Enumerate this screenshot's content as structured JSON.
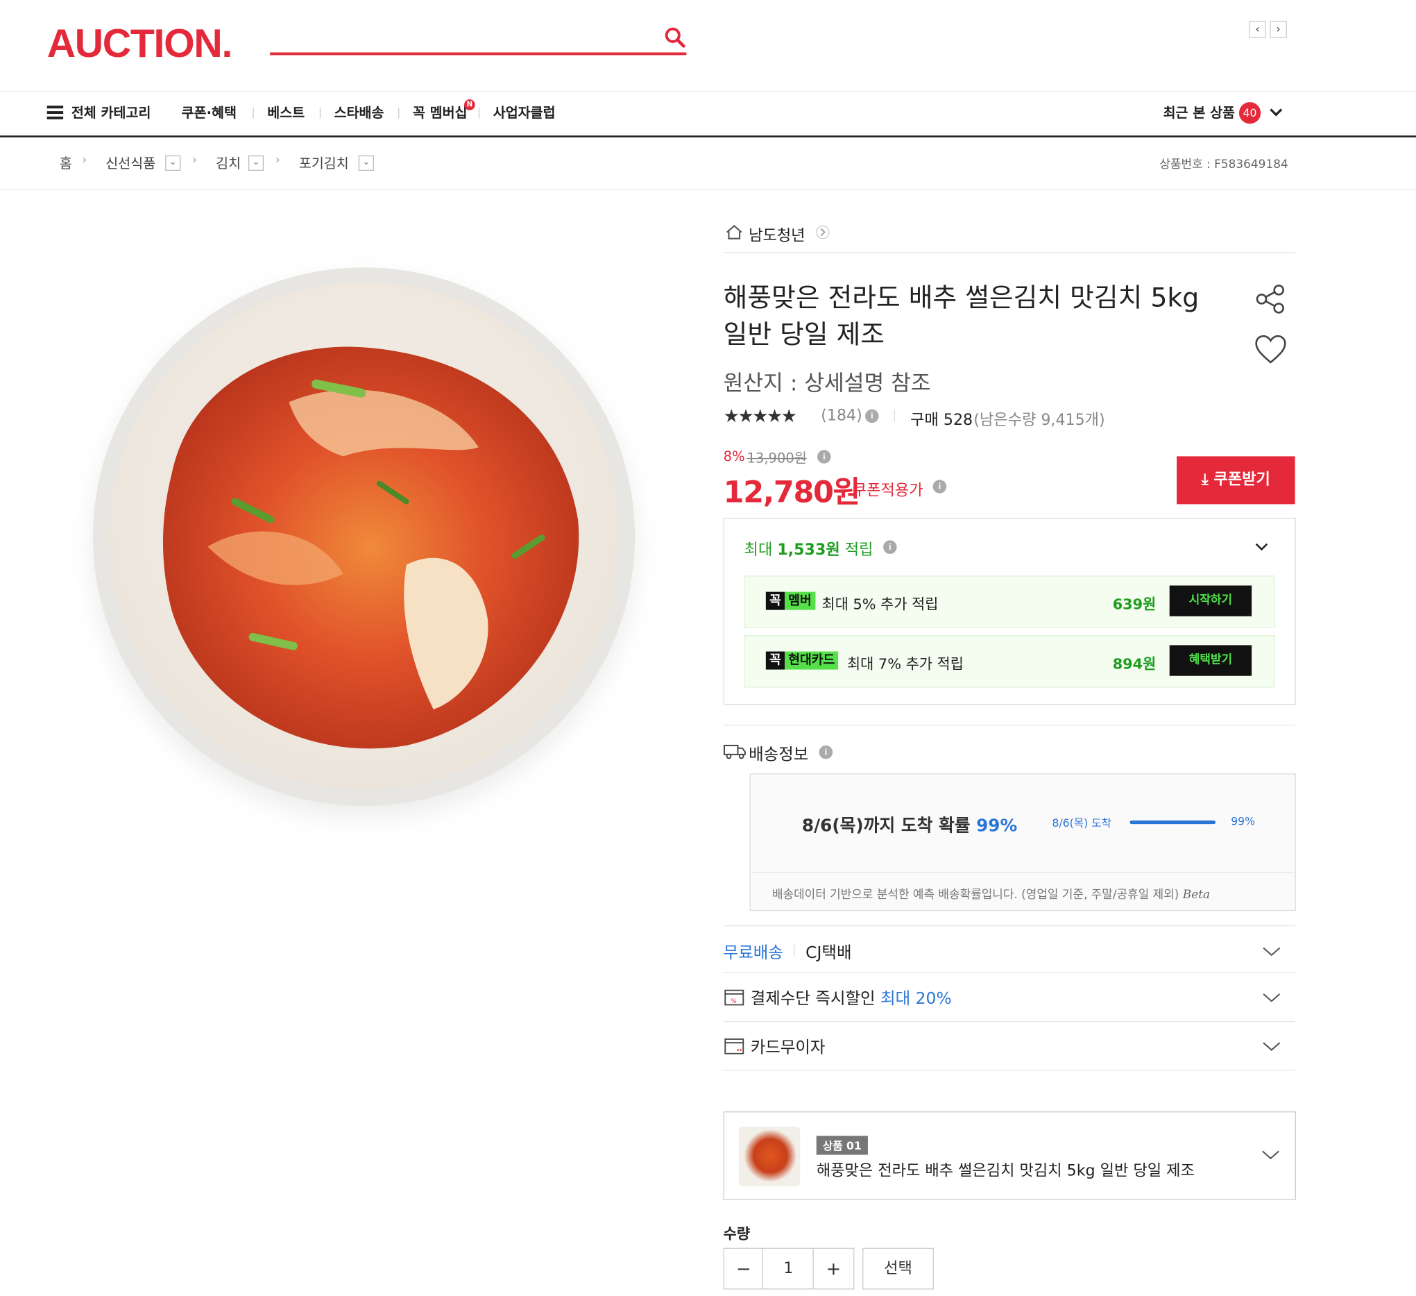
{
  "header": {
    "logo": "AUCTION.",
    "nav": {
      "all_categories": "전체 카테고리",
      "items": [
        "쿠폰·혜택",
        "베스트",
        "스타배송",
        "꼭 멤버십",
        "사업자클럽"
      ],
      "membership_badge": "N",
      "recent_label": "최근 본 상품",
      "recent_count": "40"
    }
  },
  "breadcrumb": {
    "home": "홈",
    "levels": [
      "신선식품",
      "김치",
      "포기김치"
    ],
    "product_number": "상품번호 : F583649184"
  },
  "product": {
    "seller": "남도청년",
    "title": "해풍맞은 전라도 배추 썰은김치 맛김치 5kg 일반 당일 제조",
    "origin": "원산지 : 상세설명 참조",
    "rating_stars": "★★★★★",
    "review_count": "(184)",
    "purchase": "구매 528",
    "remaining": "(남은수량 9,415개)",
    "discount_pct": "8%",
    "original_price": "13,900원",
    "price": "12,780원",
    "price_label": "쿠폰적용가",
    "coupon_button": "쿠폰받기"
  },
  "points": {
    "header_prefix": "최대 ",
    "header_amount": "1,533원",
    "header_suffix": " 적립",
    "rows": [
      {
        "tag_a": "꼭",
        "tag_b": "멤버",
        "text": "최대 5% 추가 적립",
        "amount": "639원",
        "button": "시작하기"
      },
      {
        "tag_a": "꼭",
        "tag_b": "현대카드",
        "text": "최대 7% 추가 적립",
        "amount": "894원",
        "button": "혜택받기"
      }
    ]
  },
  "shipping": {
    "header": "배송정보",
    "main_prefix": "8/6(목)까지 도착 확률 ",
    "main_pct": "99%",
    "mini_date": "8/6(목) 도착",
    "mini_pct": "99%",
    "note": "배송데이터 기반으로 분석한 예측 배송확률입니다. (영업일 기준, 주말/공휴일 제외)",
    "beta": "Beta",
    "free_label": "무료배송",
    "courier": "CJ택배",
    "payment_label": "결제수단 즉시할인",
    "payment_highlight": "최대 20%",
    "installment_label": "카드무이자"
  },
  "selection": {
    "tag": "상품 01",
    "name": "해풍맞은 전라도 배추 썰은김치 맛김치 5kg 일반 당일 제조",
    "qty_label": "수량",
    "qty_value": "1",
    "minus": "−",
    "plus": "+",
    "select_button": "선택"
  },
  "colors": {
    "brand": "#e4293a",
    "green": "#1f9d1f",
    "blue": "#2a75d8"
  }
}
